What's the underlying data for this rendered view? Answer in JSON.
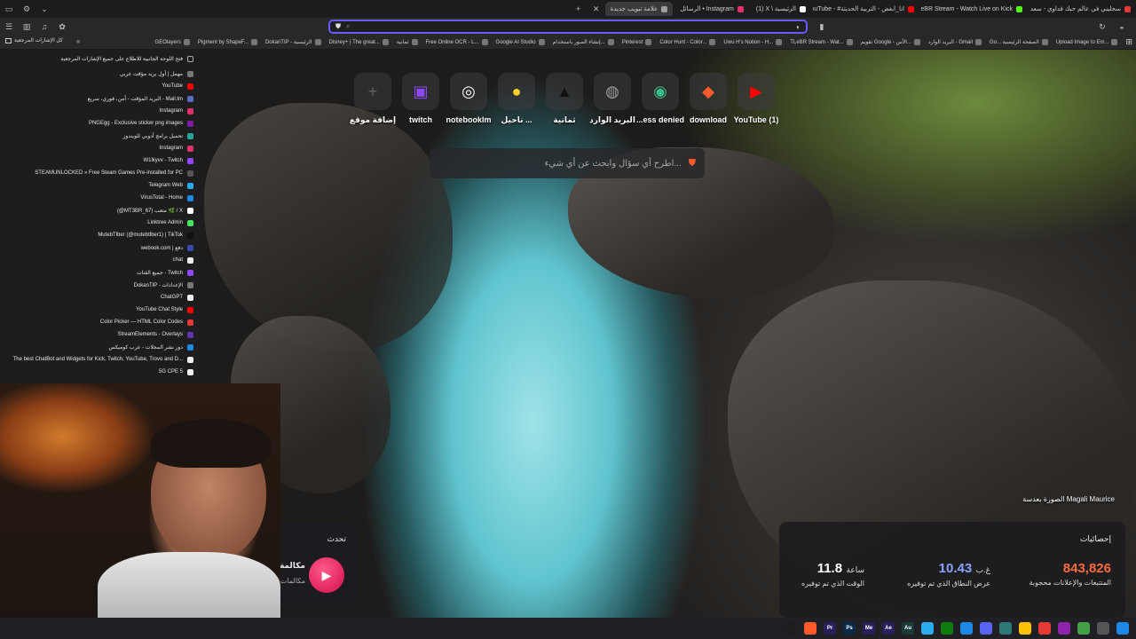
{
  "tabs": [
    {
      "label": "سجليني في عالم حبك فداوي - سعد بن",
      "color": "#e53935"
    },
    {
      "label": "TLeBR Stream - Watch Live on Kick",
      "color": "#53fc18"
    },
    {
      "label": "YouTube - #انا_ابغض - التربية الحديثة",
      "color": "#ff0000"
    },
    {
      "label": "(1) X \\ الرئيسية",
      "color": "#ffffff"
    },
    {
      "label": "الرسائل • Instagram",
      "color": "#e1306c"
    },
    {
      "label": "علامة تبويب جديدة",
      "color": "#9e9e9e",
      "active": true
    }
  ],
  "address_placeholder": "",
  "bookmarks": [
    "كل الإشارات المرجعية",
    "GEOlayers",
    "Pigment by ShapeF...",
    "DokanTIP - الرئيسية",
    "Disney+ | The great...",
    "ثمانية",
    "Free Online OCR - L...",
    "Google AI Studio",
    "إنشاء الصور باستخدام...",
    "Pinterest",
    "Color Hunt - Color...",
    "Uwu H's Notion - H...",
    "TLeBR Stream - Wat...",
    "تقويم Google - الأس...",
    "البريد الوارد - Gmail",
    "Go... الصفحة الرئيسية",
    "Upload Image to Em..."
  ],
  "sidebar": {
    "header": "فتح اللوحة الجانبية للاطلاع على جميع الإشارات المرجعية",
    "items": [
      {
        "label": "مهمل | أول بريد مؤقت عربي",
        "color": "#777"
      },
      {
        "label": "YouTube",
        "color": "#ff0000"
      },
      {
        "label": "البريد المؤقت - أمن، فوري، سريع - Mail.tm",
        "color": "#5c6bc0"
      },
      {
        "label": "Instagram",
        "color": "#e1306c"
      },
      {
        "label": "PNGEgg - Exclusive sticker png images",
        "color": "#7b1fa2"
      },
      {
        "label": "تحميل برامج أدوبي للويندوز",
        "color": "#26a69a"
      },
      {
        "label": "Instagram",
        "color": "#e1306c"
      },
      {
        "label": "W1lkyvv - Twitch",
        "color": "#9146ff"
      },
      {
        "label": "STEAMUNLOCKED » Free Steam Games Pre-installed for PC",
        "color": "#555"
      },
      {
        "label": "Telegram Web",
        "color": "#2aabee"
      },
      {
        "label": "VirusTotal - Home",
        "color": "#1e88e5"
      },
      {
        "label": "(@MT3BR_67) متعب 🌿 / X",
        "color": "#ffffff"
      },
      {
        "label": "Linktree Admin",
        "color": "#43e660"
      },
      {
        "label": "MutebTlber (@mutebtlber1) | TikTok",
        "color": "#111"
      },
      {
        "label": "webook.com | دفع",
        "color": "#3949ab"
      },
      {
        "label": "chat",
        "color": "#eee"
      },
      {
        "label": "جميع القنات - Twitch",
        "color": "#9146ff"
      },
      {
        "label": "DokanTIP - الإعدادات",
        "color": "#777"
      },
      {
        "label": "ChatGPT",
        "color": "#eee"
      },
      {
        "label": "YouTube Chat Style",
        "color": "#ff0000"
      },
      {
        "label": "Color Picker — HTML Color Codes",
        "color": "#e53935"
      },
      {
        "label": "StreamElements - Overlays",
        "color": "#5e35b1"
      },
      {
        "label": "دور نشر المجلات - عرب كوميكس",
        "color": "#1e88e5"
      },
      {
        "label": "The best ChatBot and Widgets for Kick, Twitch, YouTube, Trovo and D...",
        "color": "#eee"
      },
      {
        "label": "5G CPE 5",
        "color": "#eee"
      }
    ]
  },
  "tiles": [
    {
      "label": "إضافة موقع",
      "icon": "plus-icon",
      "glyph": "+",
      "color": "rgba(120,120,125,0.7)"
    },
    {
      "label": "twitch",
      "icon": "twitch-icon",
      "glyph": "▣",
      "color": "#9146ff"
    },
    {
      "label": "notebooklm",
      "icon": "notebooklm-icon",
      "glyph": "◎",
      "color": "#ffffff"
    },
    {
      "label": "ناحيل ...",
      "icon": "pin-icon",
      "glyph": "●",
      "color": "#ffd12a"
    },
    {
      "label": "ثمانية",
      "icon": "thmanyah-icon",
      "glyph": "▲",
      "color": "#111111"
    },
    {
      "label": "البريد الوارد",
      "icon": "globe-icon",
      "glyph": "◍",
      "color": "#9e9e9e"
    },
    {
      "label": "...ess denied",
      "icon": "access-denied-icon",
      "glyph": "◉",
      "color": "#3bbf8a"
    },
    {
      "label": "download",
      "icon": "brave-icon",
      "glyph": "◆",
      "color": "#ff5a2c"
    },
    {
      "label": "YouTube (1)",
      "icon": "youtube-icon",
      "glyph": "▶",
      "color": "#ff0000"
    }
  ],
  "search_placeholder": "اطرح أي سؤال وابحث عن أي شيء...",
  "photo_credit": "الصورة بعدسة Magali Maurice",
  "stats": {
    "title": "إحصائيات",
    "items": [
      {
        "value": "843,826",
        "unit": "",
        "label": "المتتبعات والإعلانات محجوبة",
        "color": "#ff6a3d"
      },
      {
        "value": "10.43",
        "unit": "غ.ب",
        "label": "عرض النطاق الذي تم توفيره",
        "color": "#8aa2ff"
      },
      {
        "value": "11.8",
        "unit": "ساعة",
        "label": "الوقت الذي تم توفيره",
        "color": "#ffffff"
      }
    ]
  },
  "call_card": {
    "title": "تحدث",
    "line1": "مكالمة",
    "line2": "مكالمات"
  },
  "taskbar": [
    {
      "label": "",
      "color": "#1e1e1e"
    },
    {
      "label": "",
      "color": "#ff5a2c"
    },
    {
      "label": "Pr",
      "color": "#2a1e5c"
    },
    {
      "label": "Ps",
      "color": "#0a2a4a"
    },
    {
      "label": "Me",
      "color": "#2a1e5c"
    },
    {
      "label": "Ae",
      "color": "#2a1e5c"
    },
    {
      "label": "Au",
      "color": "#1a3a3a"
    },
    {
      "label": "",
      "color": "#2aabee"
    },
    {
      "label": "",
      "color": "#107c10"
    },
    {
      "label": "",
      "color": "#1e88e5"
    },
    {
      "label": "",
      "color": "#5865f2"
    },
    {
      "label": "",
      "color": "#2b7a78"
    },
    {
      "label": "",
      "color": "#ffc107"
    },
    {
      "label": "",
      "color": "#e53935"
    },
    {
      "label": "",
      "color": "#8e24aa"
    },
    {
      "label": "",
      "color": "#43a047"
    },
    {
      "label": "",
      "color": "#555"
    },
    {
      "label": "",
      "color": "#1e88e5"
    }
  ]
}
